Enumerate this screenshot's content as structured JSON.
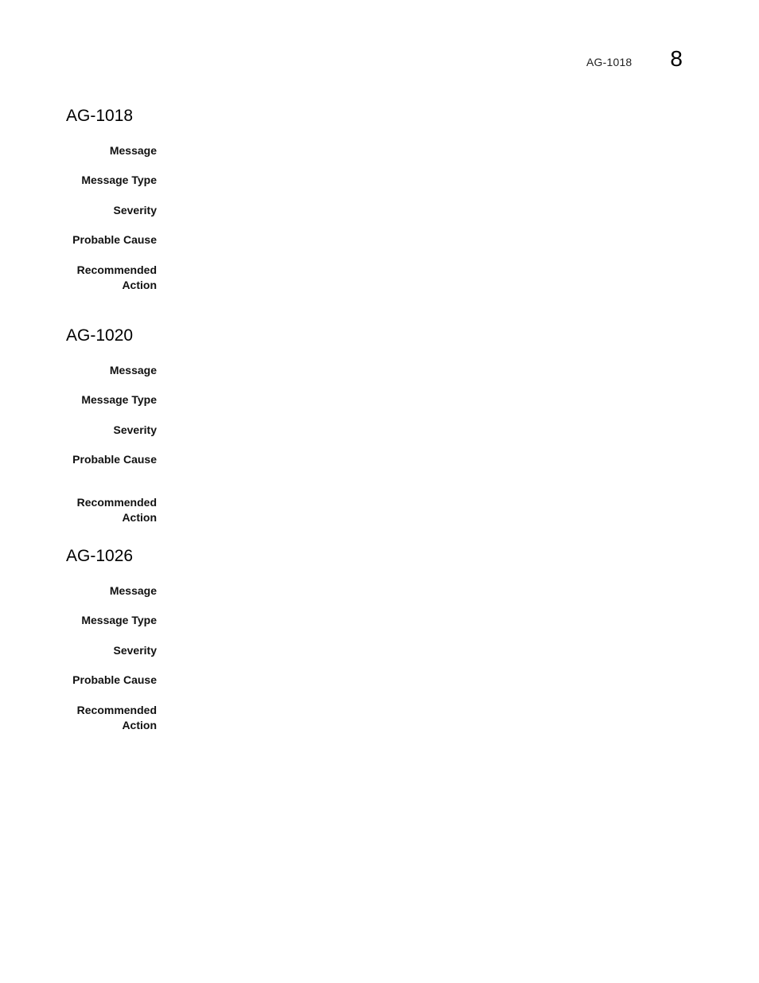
{
  "header": {
    "running_title": "AG-1018",
    "chapter_number": "8"
  },
  "sections": [
    {
      "title": "AG-1018",
      "fields": [
        {
          "label": "Message",
          "value": ""
        },
        {
          "label": "Message Type",
          "value": ""
        },
        {
          "label": "Severity",
          "value": ""
        },
        {
          "label": "Probable Cause",
          "value": ""
        },
        {
          "label_line1": "Recommended",
          "label_line2": "Action",
          "value": ""
        }
      ]
    },
    {
      "title": "AG-1020",
      "fields": [
        {
          "label": "Message",
          "value": ""
        },
        {
          "label": "Message Type",
          "value": ""
        },
        {
          "label": "Severity",
          "value": ""
        },
        {
          "label": "Probable Cause",
          "value": ""
        },
        {
          "label_line1": "Recommended",
          "label_line2": "Action",
          "value": ""
        }
      ]
    },
    {
      "title": "AG-1026",
      "fields": [
        {
          "label": "Message",
          "value": ""
        },
        {
          "label": "Message Type",
          "value": ""
        },
        {
          "label": "Severity",
          "value": ""
        },
        {
          "label": "Probable Cause",
          "value": ""
        },
        {
          "label_line1": "Recommended",
          "label_line2": "Action",
          "value": ""
        }
      ]
    }
  ]
}
